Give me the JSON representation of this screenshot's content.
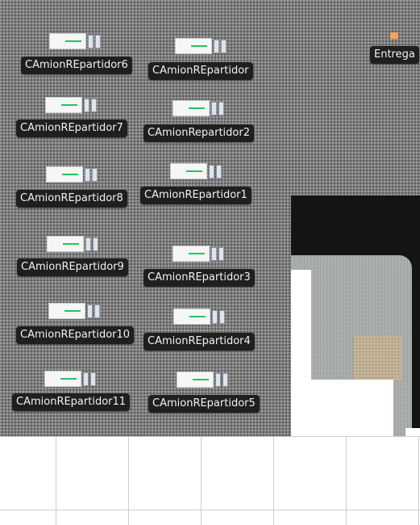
{
  "scene": {
    "delivery_label": "Entrega",
    "vehicles": [
      {
        "label": "CAmionREpartidor6"
      },
      {
        "label": "CAmionREpartidor"
      },
      {
        "label": "CAmionREpartidor7"
      },
      {
        "label": "CAmionRepartidor2"
      },
      {
        "label": "CAmionREpartidor8"
      },
      {
        "label": "CAmionREpartidor1"
      },
      {
        "label": "CAmionREpartidor9"
      },
      {
        "label": "CAmionREpartidor3"
      },
      {
        "label": "CAmionREpartidor10"
      },
      {
        "label": "CAmionREpartidor4"
      },
      {
        "label": "CAmionREpartidor11"
      },
      {
        "label": "CAmionREpartidor5"
      }
    ],
    "colors": {
      "marker": "#f5a25a",
      "stripe": "#22c55e",
      "label_bg": "#1f1f1f"
    }
  }
}
